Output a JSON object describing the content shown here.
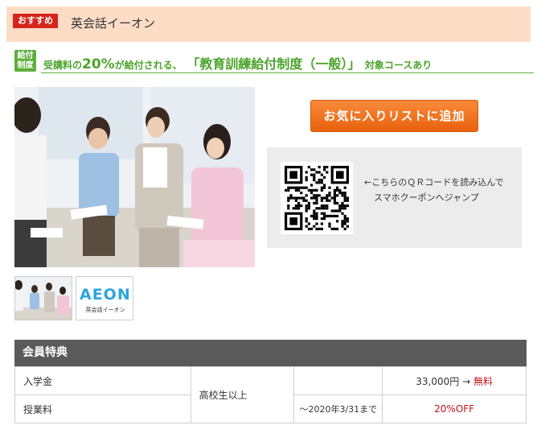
{
  "header": {
    "badge": "おすすめ",
    "school_name": "英会話イーオン"
  },
  "grant": {
    "icon_line1": "給付",
    "icon_line2": "制度",
    "part1": "受講料の",
    "percent": "20%",
    "part2": "が給付される、",
    "program": "「教育訓練給付制度（一般）」",
    "part3": "対象コースあり"
  },
  "thumbnails": {
    "logo_text": "AEON",
    "logo_sub": "英会話イーオン"
  },
  "favorite_button": "お気に入りリストに追加",
  "qr": {
    "line1": "←こちらのＱＲコードを読み込んで",
    "line2": "スマホクーポンへジャンプ"
  },
  "benefits": {
    "title": "会員特典",
    "rows": [
      {
        "item": "入学金",
        "condition": "高校生以上",
        "period": "",
        "price_old": "33,000円",
        "arrow": "→",
        "price_new": "無料"
      },
      {
        "item": "授業料",
        "period": "～2020年3/31まで",
        "discount": "20%OFF"
      }
    ]
  },
  "colors": {
    "header_bg": "#fddcc5",
    "badge_red": "#d6251a",
    "grant_green": "#4da32c",
    "button_orange": "#ef7020",
    "table_header": "#5a5a5a",
    "accent_red": "#c0161c"
  }
}
